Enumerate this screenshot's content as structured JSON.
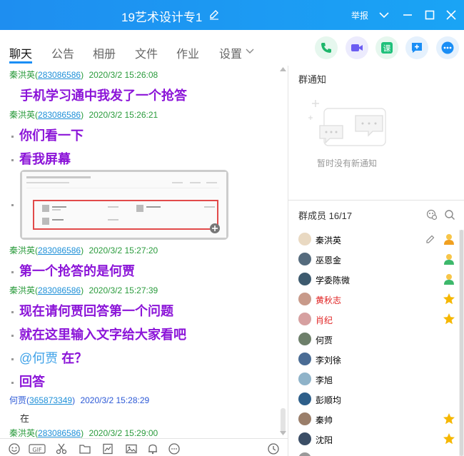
{
  "window": {
    "title": "19艺术设计专1",
    "report_label": "举报"
  },
  "tabs": [
    "聊天",
    "公告",
    "相册",
    "文件",
    "作业",
    "设置"
  ],
  "header_actions": [
    "phone-call-icon",
    "video-call-icon",
    "class-icon",
    "add-app-icon",
    "more-icon"
  ],
  "colors": {
    "titlebar": "#1e8ef0",
    "accent": "#1a8ef5",
    "message_purple": "#8b14d8",
    "link": "#1d8fd8",
    "sender_green": "#2a9b3c",
    "admin_red": "#e02020",
    "star_gold": "#f5b700"
  },
  "chat": {
    "messages": [
      {
        "sender": "秦洪英",
        "uid": "283086586",
        "time": "2020/3/2 15:26:08",
        "lines": [
          "手机学习通中我发了一个抢答"
        ]
      },
      {
        "sender": "秦洪英",
        "uid": "283086586",
        "time": "2020/3/2 15:26:21",
        "lines": [
          "你们看一下",
          "看我屏幕"
        ],
        "has_image": true
      },
      {
        "sender": "秦洪英",
        "uid": "283086586",
        "time": "2020/3/2 15:27:20",
        "lines": [
          "第一个抢答的是何贾"
        ]
      },
      {
        "sender": "秦洪英",
        "uid": "283086586",
        "time": "2020/3/2 15:27:39",
        "lines": [
          "现在请何贾回答第一个问题",
          "就在这里输入文字给大家看吧"
        ],
        "mention": "@何贾",
        "mention_text": "在？",
        "last": "回答"
      },
      {
        "sender": "何贾",
        "uid": "365873349",
        "time": "2020/3/2 15:28:29",
        "plain": "在"
      },
      {
        "sender": "秦洪英",
        "uid": "283086586",
        "time": "2020/3/2 15:29:00"
      }
    ]
  },
  "toolbar_icons": [
    "emoji-icon",
    "gif-icon",
    "scissors-icon",
    "folder-icon",
    "image-icon",
    "picture-icon",
    "bell-icon",
    "more-icon",
    "history-icon"
  ],
  "notice": {
    "title": "群通知",
    "empty_text": "暂时没有新通知"
  },
  "members": {
    "title": "群成员 16/17",
    "list": [
      {
        "name": "秦洪英",
        "color": "#222",
        "badge": "owner"
      },
      {
        "name": "巫恩金",
        "color": "#222",
        "badge": "admin"
      },
      {
        "name": "学委陈微",
        "color": "#222",
        "badge": "admin"
      },
      {
        "name": "黄秋志",
        "color": "#e02020",
        "badge": "star"
      },
      {
        "name": "肖纪",
        "color": "#e02020",
        "badge": "star"
      },
      {
        "name": "何贾",
        "color": "#222",
        "badge": ""
      },
      {
        "name": "李刘徐",
        "color": "#222",
        "badge": ""
      },
      {
        "name": "李旭",
        "color": "#222",
        "badge": ""
      },
      {
        "name": "彭顺均",
        "color": "#222",
        "badge": ""
      },
      {
        "name": "秦帅",
        "color": "#222",
        "badge": "star"
      },
      {
        "name": "沈阳",
        "color": "#222",
        "badge": "star"
      }
    ]
  }
}
